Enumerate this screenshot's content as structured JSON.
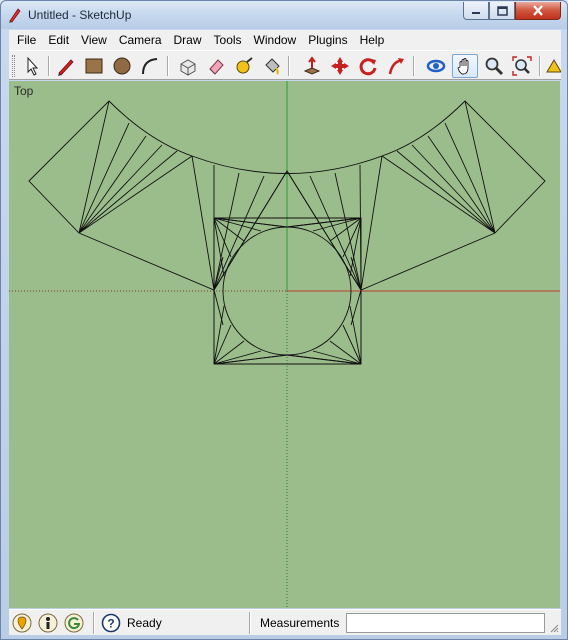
{
  "window": {
    "title": "Untitled - SketchUp"
  },
  "menubar": {
    "items": [
      "File",
      "Edit",
      "View",
      "Camera",
      "Draw",
      "Tools",
      "Window",
      "Plugins",
      "Help"
    ]
  },
  "toolbar": {
    "tools": [
      "select-arrow-icon",
      "pencil-line-icon",
      "rectangle-icon",
      "circle-icon",
      "arc-icon",
      "make-component-icon",
      "eraser-icon",
      "tape-measure-icon",
      "paint-bucket-icon",
      "push-pull-icon",
      "move-icon",
      "rotate-icon",
      "follow-me-icon",
      "orbit-icon",
      "pan-icon",
      "zoom-icon",
      "zoom-extents-icon",
      "warehouse-icon"
    ],
    "active_tool": "pan-icon"
  },
  "viewport": {
    "scene_label": "Top",
    "background_color": "#9bbd8c",
    "axis_colors": {
      "red": "#c0392b",
      "green": "#2e9a3a"
    }
  },
  "statusbar": {
    "icons": [
      "geo-location-icon",
      "credits-icon",
      "google-sign-in-icon",
      "help-icon"
    ],
    "status_text": "Ready",
    "measurements_label": "Measurements",
    "measurements_value": ""
  }
}
